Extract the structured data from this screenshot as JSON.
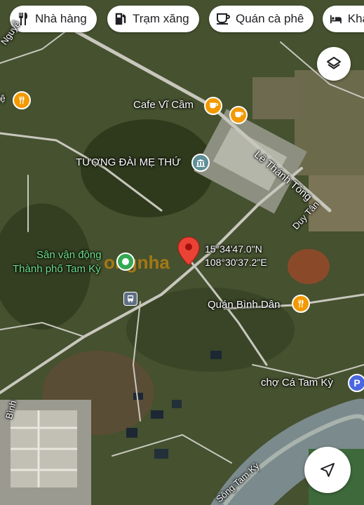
{
  "filters": [
    {
      "label": "Nhà hàng",
      "icon": "fork-knife-icon"
    },
    {
      "label": "Trạm xăng",
      "icon": "gas-pump-icon"
    },
    {
      "label": "Quán cà phê",
      "icon": "coffee-cup-icon"
    },
    {
      "label": "Khá",
      "icon": "bed-icon"
    }
  ],
  "pin": {
    "lat": "15°34'47.0\"N",
    "lng": "108°30'37.2\"E"
  },
  "places": {
    "cafe": "Cafe Vĩ Cầm",
    "monument": "TƯỢNG ĐÀI MẸ THỨ",
    "stadium_line1": "Sân vận động",
    "stadium_line2": "Thành phố Tam Kỳ",
    "restaurant": "Quán Bình Dân",
    "market": "chợ Cá Tam Kỳ"
  },
  "roads": {
    "le_thanh_tong": "Lê Thánh Tông",
    "duy_tan": "Duy Tân",
    "song_tam_ky": "Sông Tam Kỳ",
    "nguyen": "Nguyễ",
    "binh": "Bình",
    "edge_e": "ệ"
  },
  "colors": {
    "restaurant": "#f29900",
    "attraction": "#5f8f96",
    "park": "#34a853",
    "parking": "#4a67e0",
    "pin": "#ea4335"
  },
  "watermark": "ongnha"
}
